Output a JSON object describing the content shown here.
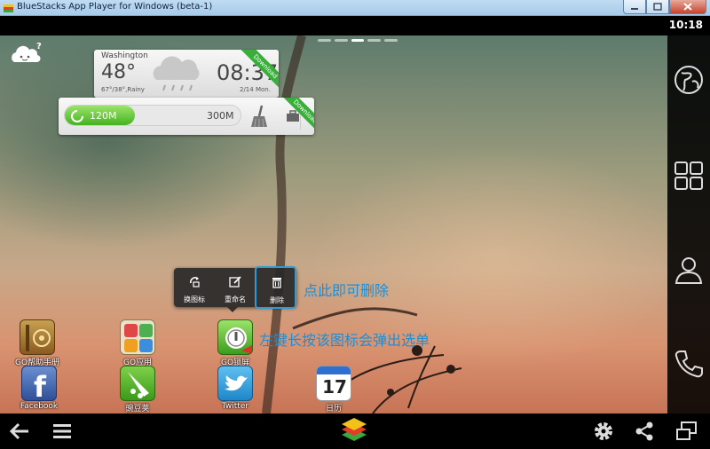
{
  "window": {
    "title": "BlueStacks App Player for Windows (beta-1)"
  },
  "status_bar": {
    "time": "10:18"
  },
  "weather_widget": {
    "city": "Washington",
    "temperature": "48°",
    "condition": "67°/38°,Rainy",
    "time": "08:37",
    "date": "2/14 Mon.",
    "ribbon": "Download"
  },
  "memory_widget": {
    "used": "120M",
    "total": "300M",
    "used_fraction": 0.4,
    "ribbon": "Download"
  },
  "context_menu": {
    "items": [
      {
        "label": "换图标",
        "icon": "change-icon-icon"
      },
      {
        "label": "重命名",
        "icon": "edit-icon"
      },
      {
        "label": "删除",
        "icon": "trash-icon"
      }
    ]
  },
  "annotations": {
    "delete_hint": "点此即可删除",
    "long_press_hint": "左键长按该图标会弹出选单"
  },
  "apps": {
    "go_help": "GO帮助手册",
    "go_apps": "GO应用",
    "go_lock": "GO锁屏",
    "facebook": "Facebook",
    "wandoujia": "豌豆荚",
    "twitter": "Twitter",
    "calendar": "日历",
    "calendar_day": "17"
  },
  "colors": {
    "accent": "#1a8fd8",
    "memory_fill": "#45b31f",
    "ribbon": "#3aae3a"
  }
}
